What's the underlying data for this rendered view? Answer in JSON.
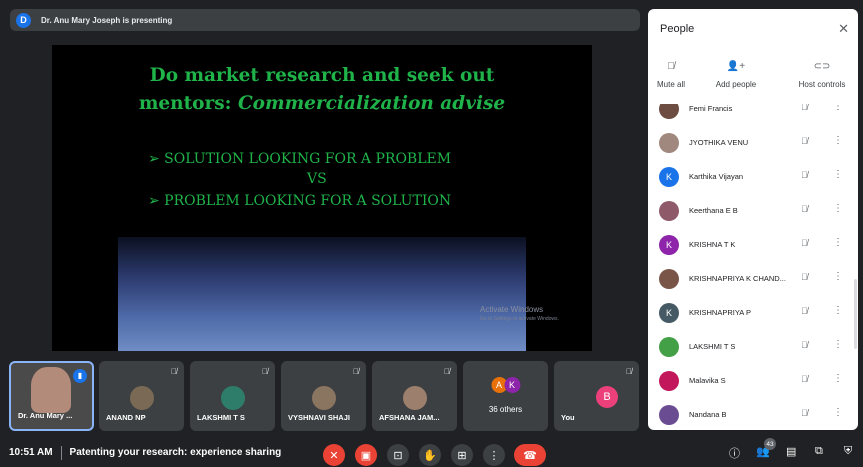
{
  "presenter_bar": {
    "avatar_letter": "D",
    "text": "Dr. Anu Mary Joseph is presenting"
  },
  "slide": {
    "title_line1": "Do market research and seek out",
    "title_line2_plain": "mentors: ",
    "title_line2_italic": "Commercialization advise",
    "bullet1": "➢ SOLUTION LOOKING FOR A PROBLEM",
    "vs": "VS",
    "bullet2": "➢ PROBLEM LOOKING FOR A SOLUTION",
    "watermark_title": "Activate Windows",
    "watermark_sub": "Go to Settings to activate Windows."
  },
  "tiles": [
    {
      "name": "Dr. Anu Mary ..."
    },
    {
      "name": "ANAND NP"
    },
    {
      "name": "LAKSHMI T S"
    },
    {
      "name": "VYSHNAVI SHAJI"
    },
    {
      "name": "AFSHANA JAM..."
    },
    {
      "name": "36 others",
      "avatars": [
        "A",
        "K"
      ]
    },
    {
      "name": "You",
      "avatar_letter": "B"
    }
  ],
  "bottom": {
    "time": "10:51 AM",
    "meeting_title": "Patenting your research: experience sharing",
    "participant_count": "43"
  },
  "people_panel": {
    "title": "People",
    "close_icon": "close-icon",
    "actions": [
      {
        "label": "Mute all",
        "icon": "mic-off-icon"
      },
      {
        "label": "Add people",
        "icon": "add-person-icon"
      },
      {
        "label": "Host controls",
        "icon": "toggle-icon"
      }
    ],
    "participants": [
      {
        "name": "Femi Francis",
        "avatar": "",
        "color": "#6d4c41"
      },
      {
        "name": "JYOTHIKA VENU",
        "avatar": "",
        "color": "#a1887f"
      },
      {
        "name": "Karthika Vijayan",
        "avatar": "K",
        "color": "#1a73e8"
      },
      {
        "name": "Keerthana E B",
        "avatar": "",
        "color": "#8e5a6a"
      },
      {
        "name": "KRISHNA T K",
        "avatar": "K",
        "color": "#8e24aa"
      },
      {
        "name": "KRISHNAPRIYA K CHAND...",
        "avatar": "",
        "color": "#795548"
      },
      {
        "name": "KRISHNAPRIYA P",
        "avatar": "K",
        "color": "#455a64"
      },
      {
        "name": "LAKSHMI T S",
        "avatar": "",
        "color": "#43a047"
      },
      {
        "name": "Malavika S",
        "avatar": "",
        "color": "#c2185b"
      },
      {
        "name": "Nandana B",
        "avatar": "",
        "color": "#6a4c93"
      }
    ]
  }
}
